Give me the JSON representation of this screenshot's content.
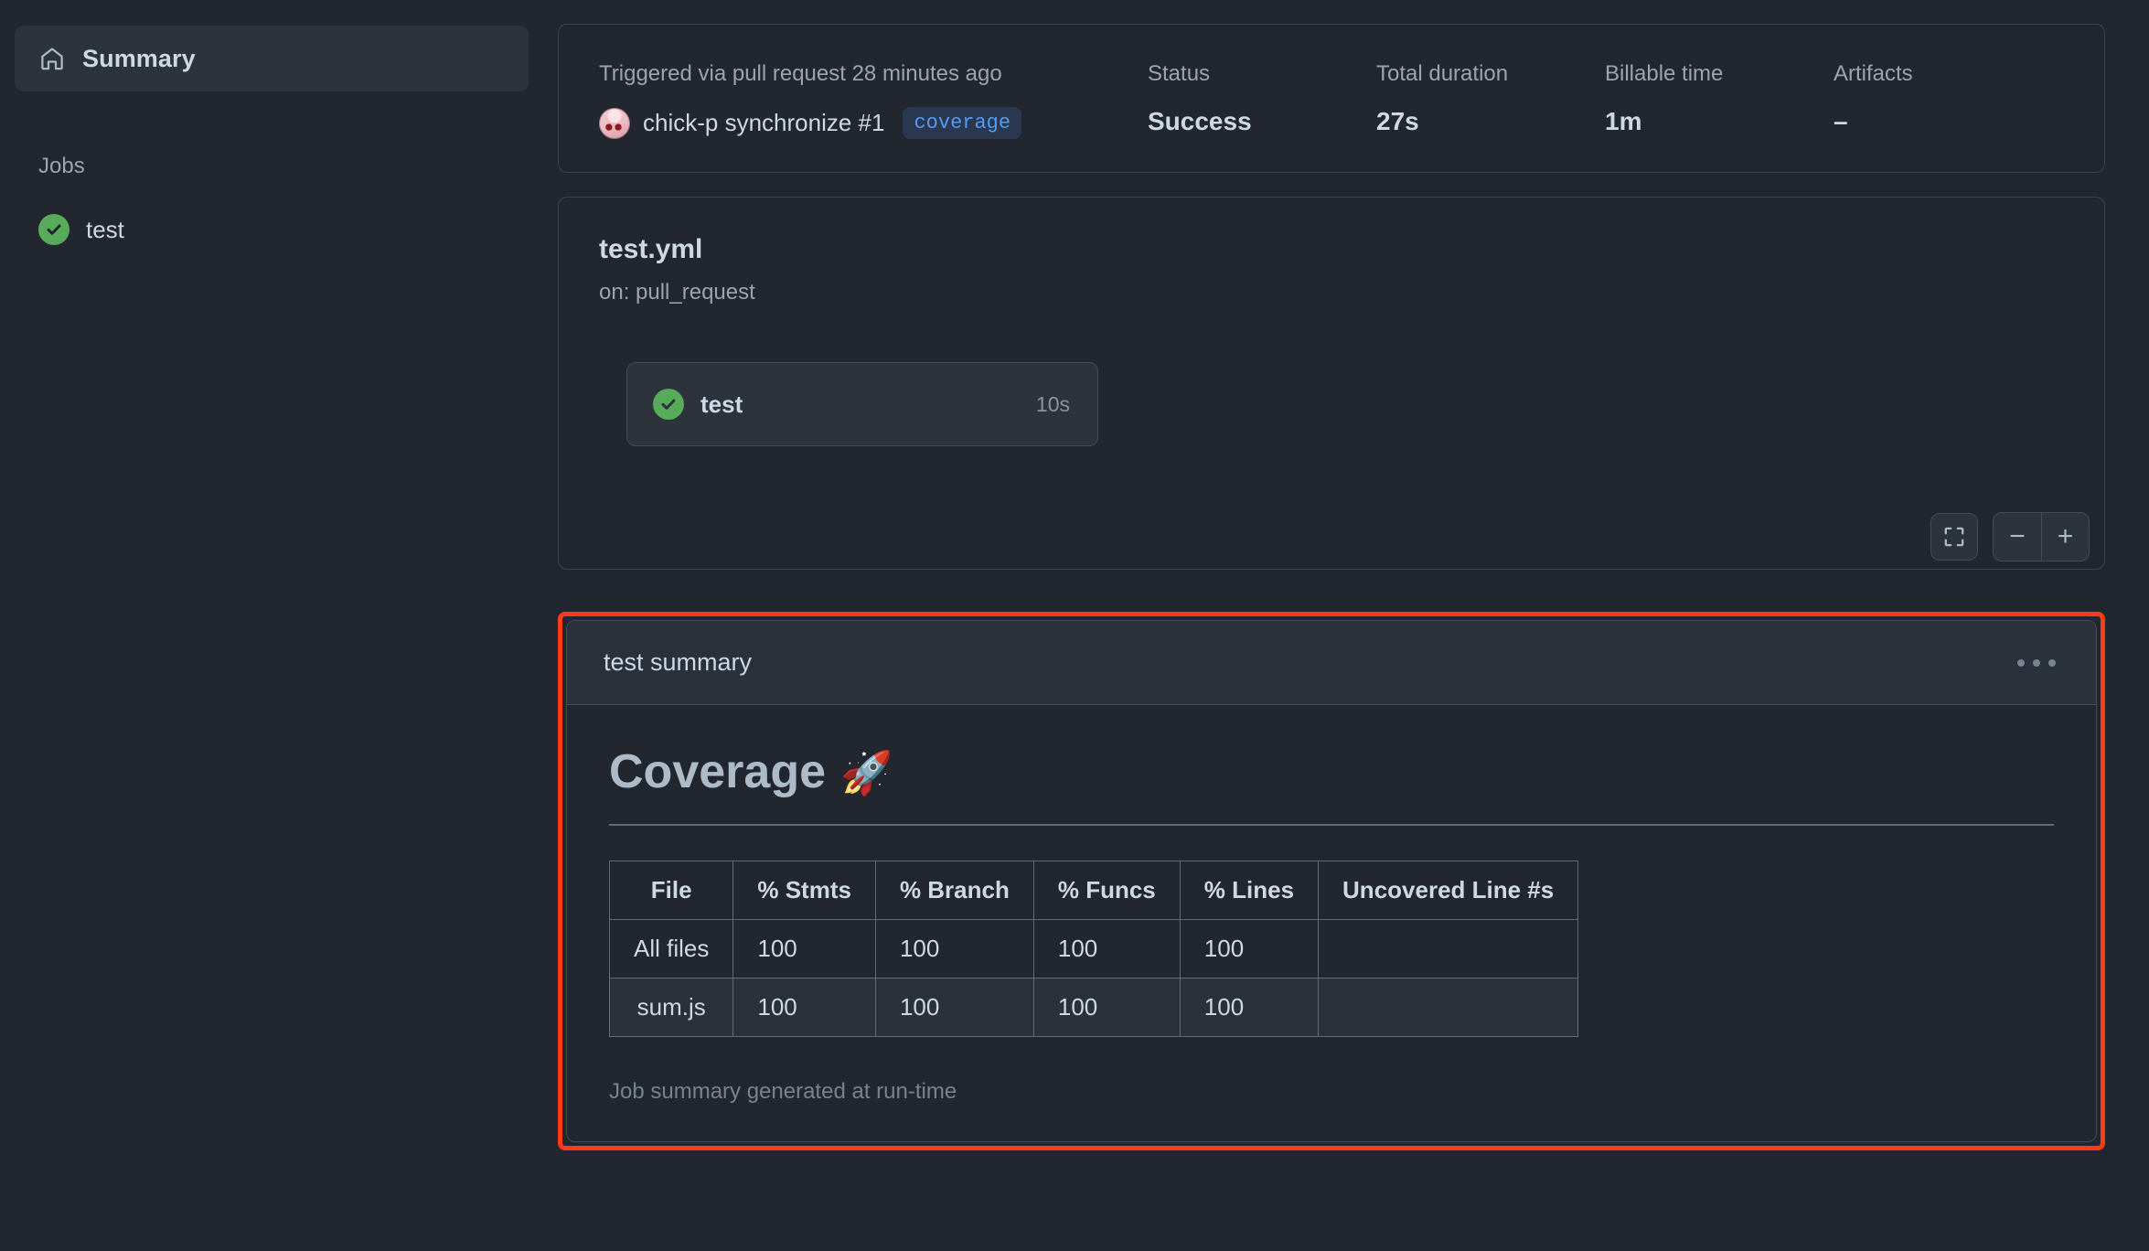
{
  "colors": {
    "page_bg": "#22272f",
    "card_bg": "#22272f",
    "card_header_bg": "#2b313a",
    "border": "#444c56",
    "success_green": "#57ab5a",
    "accent_blue": "#539bf5",
    "highlight_red": "#ff3b14",
    "text_primary": "#cdd9e5",
    "text_muted": "#9aa5b1"
  },
  "sidebar": {
    "summary": {
      "label": "Summary",
      "icon": "home-icon"
    },
    "jobs_heading": "Jobs",
    "jobs": [
      {
        "label": "test",
        "status": "success",
        "icon": "check-circle-icon"
      }
    ]
  },
  "run_header": {
    "trigger_text": "Triggered via pull request 28 minutes ago",
    "actor_text": "chick-p synchronize #1",
    "branch_badge": "coverage",
    "meta": [
      {
        "label": "Status",
        "value": "Success"
      },
      {
        "label": "Total duration",
        "value": "27s"
      },
      {
        "label": "Billable time",
        "value": "1m"
      },
      {
        "label": "Artifacts",
        "value": "–"
      }
    ]
  },
  "workflow": {
    "file_name": "test.yml",
    "trigger": "on: pull_request",
    "node": {
      "label": "test",
      "duration": "10s",
      "status": "success"
    },
    "controls": {
      "fit_screen": "fit-screen-icon",
      "zoom_out": "−",
      "zoom_in": "+"
    }
  },
  "job_summary": {
    "title": "test summary",
    "menu_icon": "kebab-menu-icon",
    "heading": "Coverage",
    "heading_emoji": "🚀",
    "footnote": "Job summary generated at run-time",
    "table": {
      "headers": [
        "File",
        "% Stmts",
        "% Branch",
        "% Funcs",
        "% Lines",
        "Uncovered Line #s"
      ],
      "rows": [
        [
          "All files",
          "100",
          "100",
          "100",
          "100",
          ""
        ],
        [
          "sum.js",
          "100",
          "100",
          "100",
          "100",
          ""
        ]
      ]
    }
  }
}
